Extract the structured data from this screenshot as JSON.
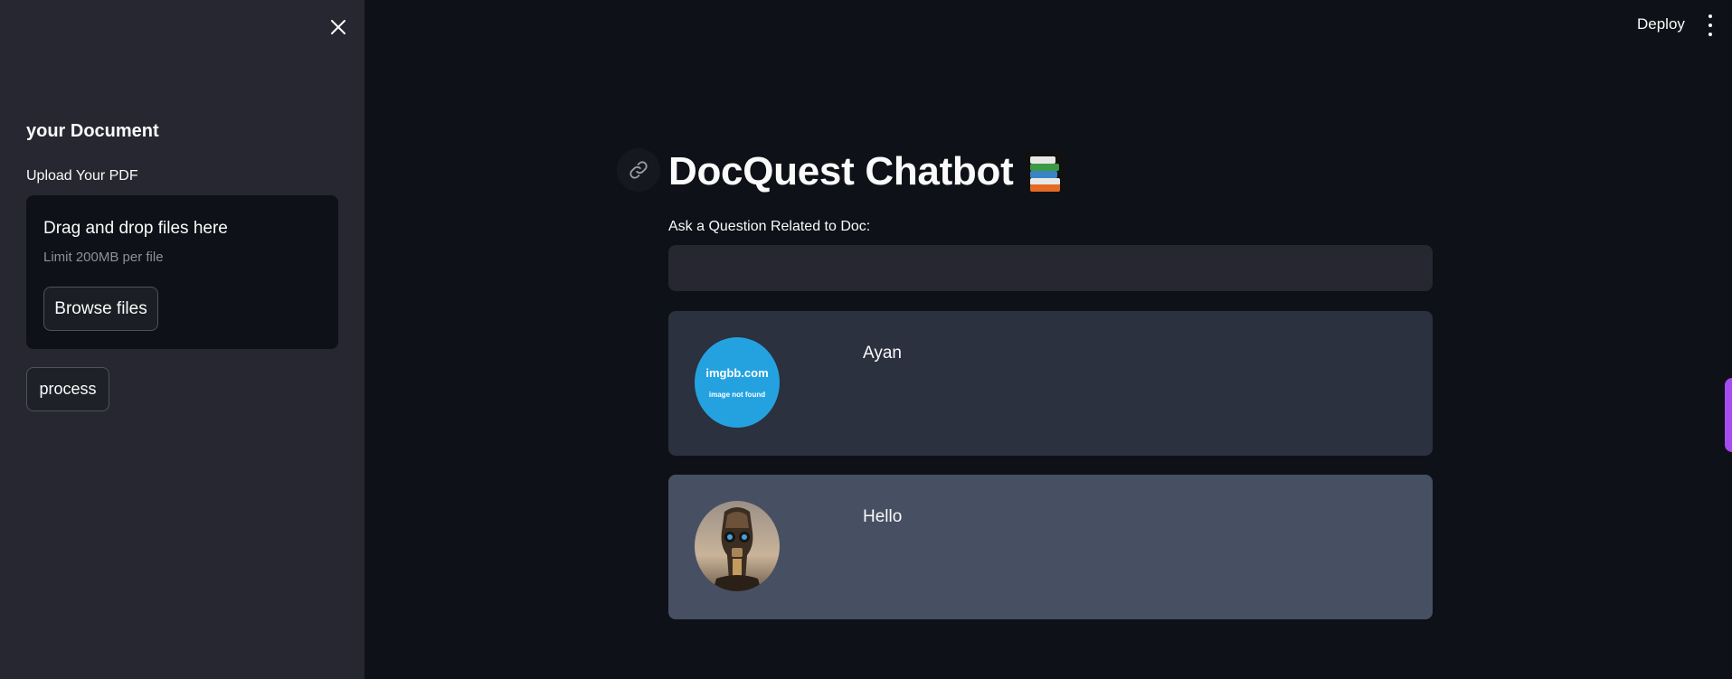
{
  "sidebar": {
    "heading": "your Document",
    "upload_label": "Upload Your PDF",
    "dropzone": {
      "title": "Drag and drop files here",
      "limit": "Limit 200MB per file",
      "browse_label": "Browse files"
    },
    "process_label": "process",
    "close_icon": "close-icon"
  },
  "header": {
    "deploy_label": "Deploy",
    "menu_icon": "kebab-menu-icon"
  },
  "main": {
    "title": "DocQuest Chatbot",
    "title_icon": "books-icon",
    "anchor_icon": "link-icon",
    "question_label": "Ask a Question Related to Doc:",
    "question_value": "",
    "messages": [
      {
        "role": "user",
        "avatar_site": "imgbb.com",
        "avatar_note": "image not found",
        "text": "Ayan"
      },
      {
        "role": "bot",
        "text": "Hello"
      }
    ]
  },
  "colors": {
    "background": "#0e1117",
    "sidebar": "#262730",
    "user_message": "#2b313e",
    "bot_message": "#475063",
    "avatar_blue": "#24a2e0",
    "accent": "#a34cf0"
  }
}
